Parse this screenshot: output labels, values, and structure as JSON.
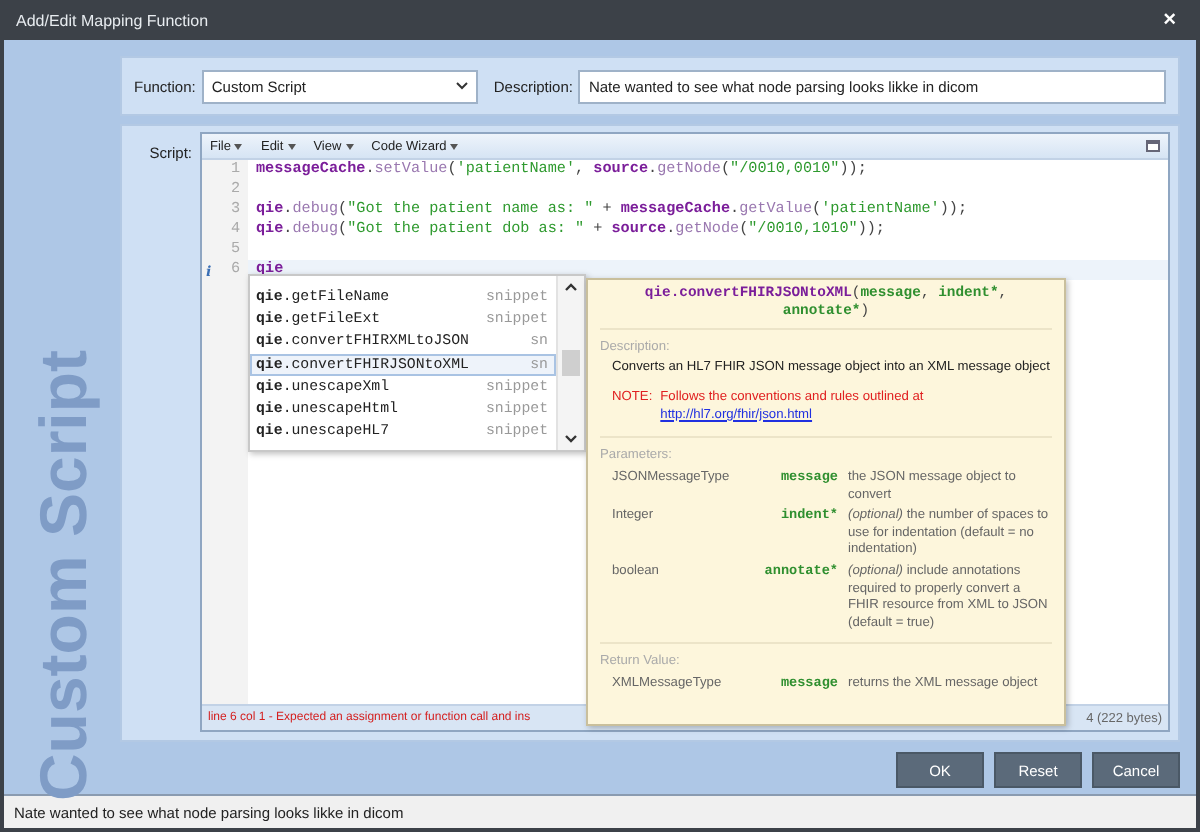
{
  "window": {
    "title": "Add/Edit Mapping Function",
    "close": "×"
  },
  "side_caption": "Custom Script",
  "function_field": {
    "label": "Function:",
    "value": "Custom Script"
  },
  "description_field": {
    "label": "Description:",
    "value": "Nate wanted to see what node parsing looks likke in dicom"
  },
  "script": {
    "label": "Script:",
    "menus": [
      "File",
      "Edit",
      "View",
      "Code Wizard"
    ],
    "lines": [
      {
        "number": "1",
        "current": false,
        "tokens": [
          {
            "kind": "object",
            "text": "messageCache"
          },
          {
            "kind": "punct",
            "text": "."
          },
          {
            "kind": "method",
            "text": "setValue"
          },
          {
            "kind": "punct",
            "text": "("
          },
          {
            "kind": "string",
            "text": "'patientName'"
          },
          {
            "kind": "punct",
            "text": ", "
          },
          {
            "kind": "object",
            "text": "source"
          },
          {
            "kind": "punct",
            "text": "."
          },
          {
            "kind": "method",
            "text": "getNode"
          },
          {
            "kind": "punct",
            "text": "("
          },
          {
            "kind": "string",
            "text": "\"/0010,0010\""
          },
          {
            "kind": "punct",
            "text": "));"
          }
        ]
      },
      {
        "number": "2",
        "current": false
      },
      {
        "number": "3",
        "current": false,
        "tokens": [
          {
            "kind": "object",
            "text": "qie"
          },
          {
            "kind": "punct",
            "text": "."
          },
          {
            "kind": "method",
            "text": "debug"
          },
          {
            "kind": "punct",
            "text": "("
          },
          {
            "kind": "string",
            "text": "\"Got the patient name as: \""
          },
          {
            "kind": "punct",
            "text": " + "
          },
          {
            "kind": "object",
            "text": "messageCache"
          },
          {
            "kind": "punct",
            "text": "."
          },
          {
            "kind": "method",
            "text": "getValue"
          },
          {
            "kind": "punct",
            "text": "("
          },
          {
            "kind": "string",
            "text": "'patientName'"
          },
          {
            "kind": "punct",
            "text": "));"
          }
        ]
      },
      {
        "number": "4",
        "current": false,
        "tokens": [
          {
            "kind": "object",
            "text": "qie"
          },
          {
            "kind": "punct",
            "text": "."
          },
          {
            "kind": "method",
            "text": "debug"
          },
          {
            "kind": "punct",
            "text": "("
          },
          {
            "kind": "string",
            "text": "\"Got the patient dob as: \""
          },
          {
            "kind": "punct",
            "text": " + "
          },
          {
            "kind": "object",
            "text": "source"
          },
          {
            "kind": "punct",
            "text": "."
          },
          {
            "kind": "method",
            "text": "getNode"
          },
          {
            "kind": "punct",
            "text": "("
          },
          {
            "kind": "string",
            "text": "\"/0010,1010\""
          },
          {
            "kind": "punct",
            "text": "));"
          }
        ]
      },
      {
        "number": "5",
        "current": false
      },
      {
        "number": "6",
        "current": true,
        "marker": "i",
        "tokens": [
          {
            "kind": "object",
            "text": "qie"
          }
        ]
      }
    ],
    "completions": [
      {
        "text": "**qie**.getFileName",
        "type": "snippet",
        "selected": false
      },
      {
        "text": "**qie**.getFileExt",
        "type": "snippet",
        "selected": false
      },
      {
        "text": "**qie**.convertFHIRXMLtoJSON",
        "type": "sn",
        "selected": false
      },
      {
        "text": "**qie**.convertFHIRJSONtoXML",
        "type": "sn",
        "selected": true
      },
      {
        "text": "**qie**.unescapeXml",
        "type": "snippet",
        "selected": false
      },
      {
        "text": "**qie**.unescapeHtml",
        "type": "snippet",
        "selected": false
      },
      {
        "text": "**qie**.unescapeHL7",
        "type": "snippet",
        "selected": false
      }
    ],
    "error": "line 6 col 1 - Expected an assignment or function call and ins",
    "size": "4  (222 bytes)"
  },
  "tooltip": {
    "signature": [
      [
        {
          "kind": "object",
          "text": "qie.convertFHIRJSONtoXML"
        },
        {
          "kind": "punct",
          "text": "("
        },
        {
          "kind": "param",
          "text": "message"
        },
        {
          "kind": "punct",
          "text": ", "
        },
        {
          "kind": "param",
          "text": "indent*"
        },
        {
          "kind": "punct",
          "text": ","
        }
      ],
      [
        {
          "kind": "param",
          "text": "annotate*"
        },
        {
          "kind": "punct",
          "text": ")"
        }
      ]
    ],
    "description_heading": "Description:",
    "description": "Converts an HL7 FHIR JSON message object into an XML message object",
    "note": {
      "label": "NOTE:",
      "text": "Follows the conventions and rules outlined at",
      "link": "http://hl7.org/fhir/json.html"
    },
    "parameters_heading": "Parameters:",
    "parameters": [
      {
        "type": "JSONMessageType",
        "name": "message",
        "description": "the JSON message object to convert"
      },
      {
        "type": "Integer",
        "name": "indent*",
        "description": "*(optional)* the number of spaces to use for indentation (default = no indentation)"
      },
      {
        "type": "boolean",
        "name": "annotate*",
        "description": "*(optional)* include annotations required to properly convert a FHIR resource from XML to JSON (default = true)"
      }
    ],
    "return_heading": "Return Value:",
    "return": {
      "type": "XMLMessageType",
      "name": "message",
      "description": "returns the XML message object"
    }
  },
  "buttons": [
    {
      "label": "OK"
    },
    {
      "label": "Reset"
    },
    {
      "label": "Cancel"
    }
  ],
  "status_bar": "Nate wanted to see what node parsing looks likke in dicom"
}
